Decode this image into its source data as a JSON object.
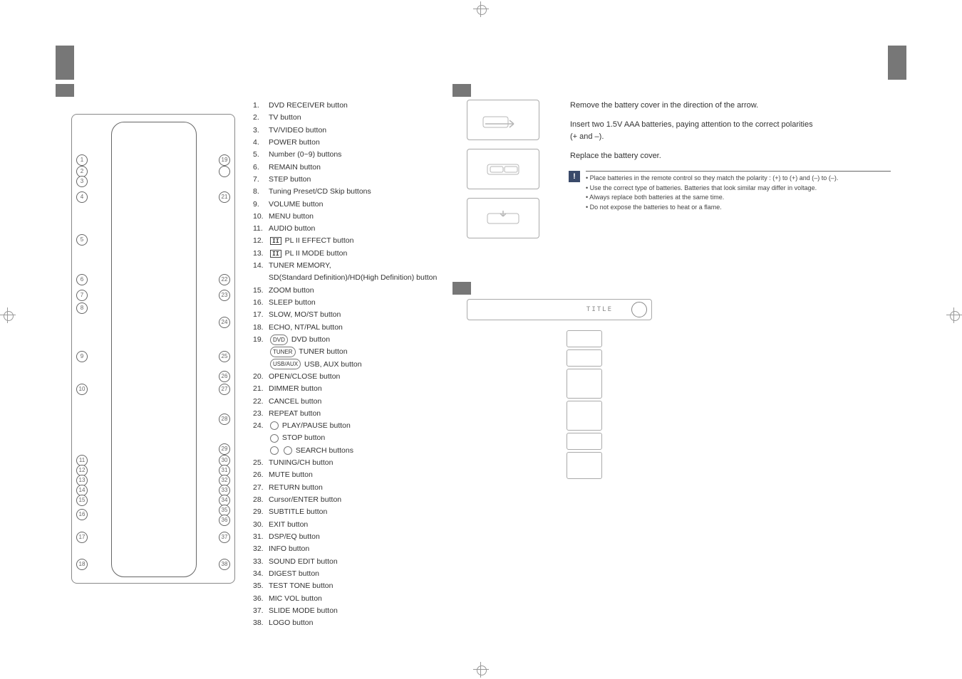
{
  "left": {
    "remote_title": ""
  },
  "middle": {
    "items": [
      {
        "n": "1.",
        "t": "DVD RECEIVER button"
      },
      {
        "n": "2.",
        "t": "TV button"
      },
      {
        "n": "3.",
        "t": "TV/VIDEO button"
      },
      {
        "n": "4.",
        "t": "POWER button"
      },
      {
        "n": "5.",
        "t": "Number (0~9) buttons"
      },
      {
        "n": "6.",
        "t": "REMAIN button"
      },
      {
        "n": "7.",
        "t": "STEP button"
      },
      {
        "n": "8.",
        "t": "Tuning Preset/CD Skip buttons"
      },
      {
        "n": "9.",
        "t": "VOLUME button"
      },
      {
        "n": "10.",
        "t": "MENU button"
      },
      {
        "n": "11.",
        "t": "AUDIO button"
      },
      {
        "n": "12.",
        "t": "PL II EFFECT button",
        "pl2": true
      },
      {
        "n": "13.",
        "t": "PL II MODE button",
        "pl2": true
      },
      {
        "n": "14.",
        "t": "TUNER MEMORY,"
      },
      {
        "n": "",
        "t": "SD(Standard Definition)/HD(High Definition) button",
        "sub": true
      },
      {
        "n": "15.",
        "t": "ZOOM button"
      },
      {
        "n": "16.",
        "t": "SLEEP button"
      },
      {
        "n": "17.",
        "t": "SLOW, MO/ST button"
      },
      {
        "n": "18.",
        "t": "ECHO, NT/PAL button"
      },
      {
        "n": "19.",
        "t": "DVD button",
        "icon": "DVD"
      },
      {
        "n": "",
        "t": "TUNER button",
        "icon": "TUNER",
        "sub": true
      },
      {
        "n": "",
        "t": "USB, AUX button",
        "icon": "USB/AUX",
        "sub": true
      },
      {
        "n": "20.",
        "t": "OPEN/CLOSE button"
      },
      {
        "n": "21.",
        "t": "DIMMER button"
      },
      {
        "n": "22.",
        "t": "CANCEL button"
      },
      {
        "n": "23.",
        "t": "REPEAT button"
      },
      {
        "n": "24.",
        "t": "PLAY/PAUSE button",
        "circ": true
      },
      {
        "n": "",
        "t": "STOP button",
        "circ": true,
        "sub": true
      },
      {
        "n": "",
        "t": "SEARCH buttons",
        "circ2": true,
        "sub": true
      },
      {
        "n": "25.",
        "t": "TUNING/CH button"
      },
      {
        "n": "26.",
        "t": "MUTE button"
      },
      {
        "n": "27.",
        "t": "RETURN button"
      },
      {
        "n": "28.",
        "t": "Cursor/ENTER button"
      },
      {
        "n": "29.",
        "t": "SUBTITLE button"
      },
      {
        "n": "30.",
        "t": "EXIT button"
      },
      {
        "n": "31.",
        "t": "DSP/EQ button"
      },
      {
        "n": "32.",
        "t": "INFO button"
      },
      {
        "n": "33.",
        "t": "SOUND EDIT button"
      },
      {
        "n": "34.",
        "t": "DIGEST button"
      },
      {
        "n": "35.",
        "t": "TEST TONE button"
      },
      {
        "n": "36.",
        "t": "MIC VOL button"
      },
      {
        "n": "37.",
        "t": "SLIDE MODE button"
      },
      {
        "n": "38.",
        "t": "LOGO button"
      }
    ]
  },
  "right": {
    "instr1": "Remove the battery cover in the direction of the arrow.",
    "instr2a": "Insert two 1.5V AAA batteries, paying attention to the correct polarities",
    "instr2b": "(+ and –).",
    "instr3": "Replace the battery cover.",
    "caution": [
      "Place batteries in the remote control so they match the polarity : (+) to (+) and (–) to (–).",
      "Use the correct type of batteries. Batteries that look similar may differ in voltage.",
      "Always replace both batteries at the same time.",
      "Do not expose the batteries to heat or a flame."
    ],
    "device_display": "TITLE"
  }
}
